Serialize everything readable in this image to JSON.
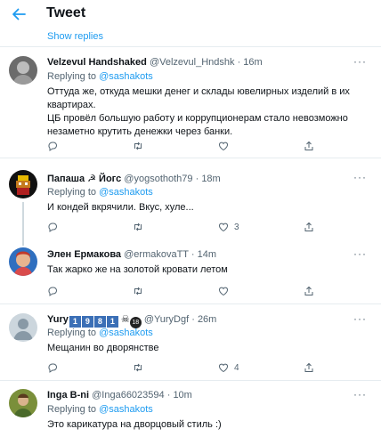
{
  "header": {
    "title": "Tweet"
  },
  "show_replies": "Show replies",
  "tweets": [
    {
      "name": "Velzevul Handshaked",
      "handle": "@Velzevul_Hndshk",
      "time": "· 16m",
      "replying_prefix": "Replying to ",
      "replying_to": "@sashakots",
      "text": [
        "Оттуда же, откуда мешки денег и склады ювелирных изделий в их квартирах.",
        "ЦБ провёл большую работу  и коррупционерам стало невозможно незаметно крутить денежки через банки."
      ],
      "counts": {
        "reply": "",
        "retweet": "",
        "like": ""
      }
    },
    {
      "name": "Папаша ☭ Йогс",
      "handle": "@yogsothoth79",
      "time": "· 18m",
      "replying_prefix": "Replying to ",
      "replying_to": "@sashakots",
      "text": [
        "И кондей вкрячили. Вкус, хуле..."
      ],
      "counts": {
        "reply": "",
        "retweet": "",
        "like": "3"
      }
    },
    {
      "name": "Элен Ермакова",
      "handle": "@ermakovaTT",
      "time": "· 14m",
      "text": [
        "Так жарко же на золотой кровати летом"
      ],
      "counts": {
        "reply": "",
        "retweet": "",
        "like": ""
      }
    },
    {
      "name": "Yury",
      "name_badges": [
        "1",
        "9",
        "8",
        "1"
      ],
      "name_suffix": "☠",
      "name_circle": "18",
      "handle": "@YuryDgf",
      "time": "· 26m",
      "replying_prefix": "Replying to ",
      "replying_to": "@sashakots",
      "text": [
        "Мещанин во дворянстве"
      ],
      "counts": {
        "reply": "",
        "retweet": "",
        "like": "4"
      }
    },
    {
      "name": "Inga B-ni",
      "handle": "@Inga66023594",
      "time": "· 10m",
      "replying_prefix": "Replying to ",
      "replying_to": "@sashakots",
      "text": [
        "Это карикатура на дворцовый стиль :)"
      ]
    }
  ],
  "more_label": "···",
  "colors": {
    "accent": "#1d9bf0",
    "secondary_text": "#536471",
    "divider": "#e6ecf0"
  }
}
